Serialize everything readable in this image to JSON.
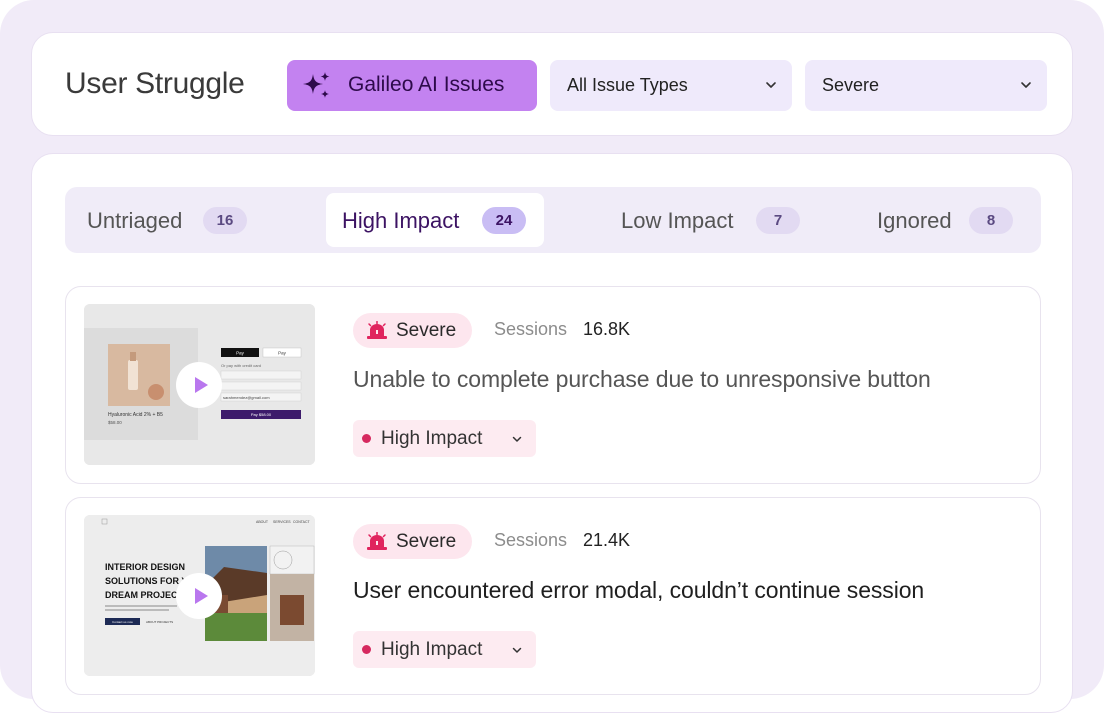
{
  "header": {
    "title": "User Struggle",
    "ai_button_label": "Galileo AI Issues",
    "ai_button_icon": "sparkles-icon",
    "type_filter": {
      "value": "All Issue Types"
    },
    "severity_filter": {
      "value": "Severe"
    }
  },
  "tabs": [
    {
      "label": "Untriaged",
      "count": "16"
    },
    {
      "label": "High Impact",
      "count": "24",
      "active": true
    },
    {
      "label": "Low Impact",
      "count": "7"
    },
    {
      "label": "Ignored",
      "count": "8"
    }
  ],
  "issues": [
    {
      "severity": "Severe",
      "sessions_label": "Sessions",
      "sessions_value": "16.8K",
      "title": "Unable to complete purchase due to unresponsive button",
      "impact": "High Impact",
      "thumbnail": {
        "kind": "checkout-page",
        "product": "Hyaluronic Acid 2% + B5",
        "price": "$58.00",
        "apple_pay": "Pay",
        "google_pay": "Pay",
        "alt_text": "Or pay with credit card",
        "email": "sarahmendez@gmail.com",
        "pay_button": "Pay $58.00"
      }
    },
    {
      "severity": "Severe",
      "sessions_label": "Sessions",
      "sessions_value": "21.4K",
      "title": "User encountered error modal, couldn’t continue session",
      "impact": "High Impact",
      "thumbnail": {
        "kind": "landing-page",
        "headline_1": "INTERIOR DESIGN",
        "headline_2": "SOLUTIONS FOR YOUR",
        "headline_3": "DREAM PROJECTS",
        "nav_1": "ABOUT",
        "nav_2": "SERVICES",
        "nav_3": "CONTACT",
        "cta_primary": "Contact us now",
        "cta_secondary": "ABOUT PROJECTS"
      }
    }
  ],
  "colors": {
    "frame_bg": "#f1ebf8",
    "ai_button_bg": "#c382f0",
    "filter_bg": "#efeafb",
    "severity_badge_bg": "#fde6ee",
    "severity_icon": "#e0245e",
    "impact_dot": "#d6295f",
    "active_tab_text": "#3c1363",
    "play_icon": "#b977ee"
  }
}
